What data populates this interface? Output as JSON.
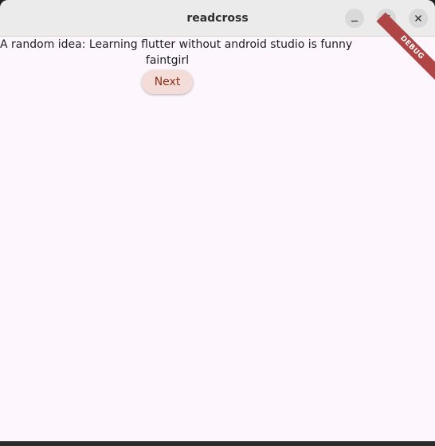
{
  "window": {
    "title": "readcross",
    "buttons": {
      "minimize_icon": "minimize-icon",
      "maximize_icon": "maximize-icon",
      "close_icon": "close-icon"
    }
  },
  "app": {
    "idea_text": "A random idea: Learning flutter without android studio is funny",
    "word_pair": "faintgirl",
    "next_button_label": "Next",
    "debug_banner": "DEBUG"
  },
  "colors": {
    "background": "#fdf7fd",
    "button_bg": "#f4ddd8",
    "button_text": "#8b2d14",
    "debug_ribbon": "#b04545"
  }
}
